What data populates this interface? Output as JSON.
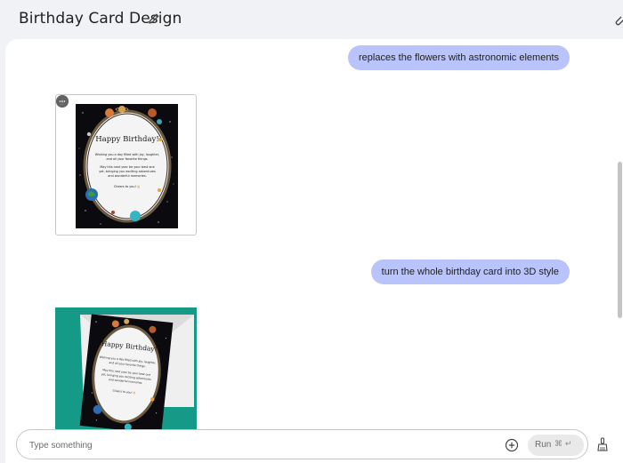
{
  "header": {
    "title": "Birthday Card Design"
  },
  "messages": [
    {
      "role": "user",
      "text": "replaces the flowers with astronomic elements"
    },
    {
      "role": "model",
      "type": "image",
      "card": {
        "heading": "Happy Birthday!",
        "line1": "Wishing you a day filled with joy, laughter,",
        "line2": "and all your favorite things.",
        "line3": "May this next year be your best one",
        "line4": "yet, bringing you exciting adventures",
        "line5": "and wonderful memories.",
        "line6": "Cheers to you! 🎂"
      }
    },
    {
      "role": "user",
      "text": "turn the whole birthday card into 3D style"
    },
    {
      "role": "model",
      "type": "image",
      "card": {
        "heading": "Happy Birthday!",
        "line1": "Wishing you a day filled with joy, laughter,",
        "line2": "and all your favorite things.",
        "line3": "May this next year be your best one",
        "line4": "yet, bringing you exciting adventures",
        "line5": "and wonderful memories.",
        "line6": "Cheers to you! 🎂"
      }
    }
  ],
  "composer": {
    "placeholder": "Type something",
    "run_label": "Run",
    "run_shortcut": "⌘ ↵"
  },
  "icons": {
    "edit": "pencil-icon",
    "attach": "paperclip-icon",
    "add": "plus-circle-icon",
    "clean": "broom-icon",
    "download": "download-icon",
    "more": "more-icon",
    "sparkle": "sparkle-icon"
  },
  "colors": {
    "page_bg": "#f0f2f5",
    "user_bubble": "#b8c4fb",
    "card_bg": "#0b0b0f",
    "card_teal_bg": "#149a86"
  }
}
